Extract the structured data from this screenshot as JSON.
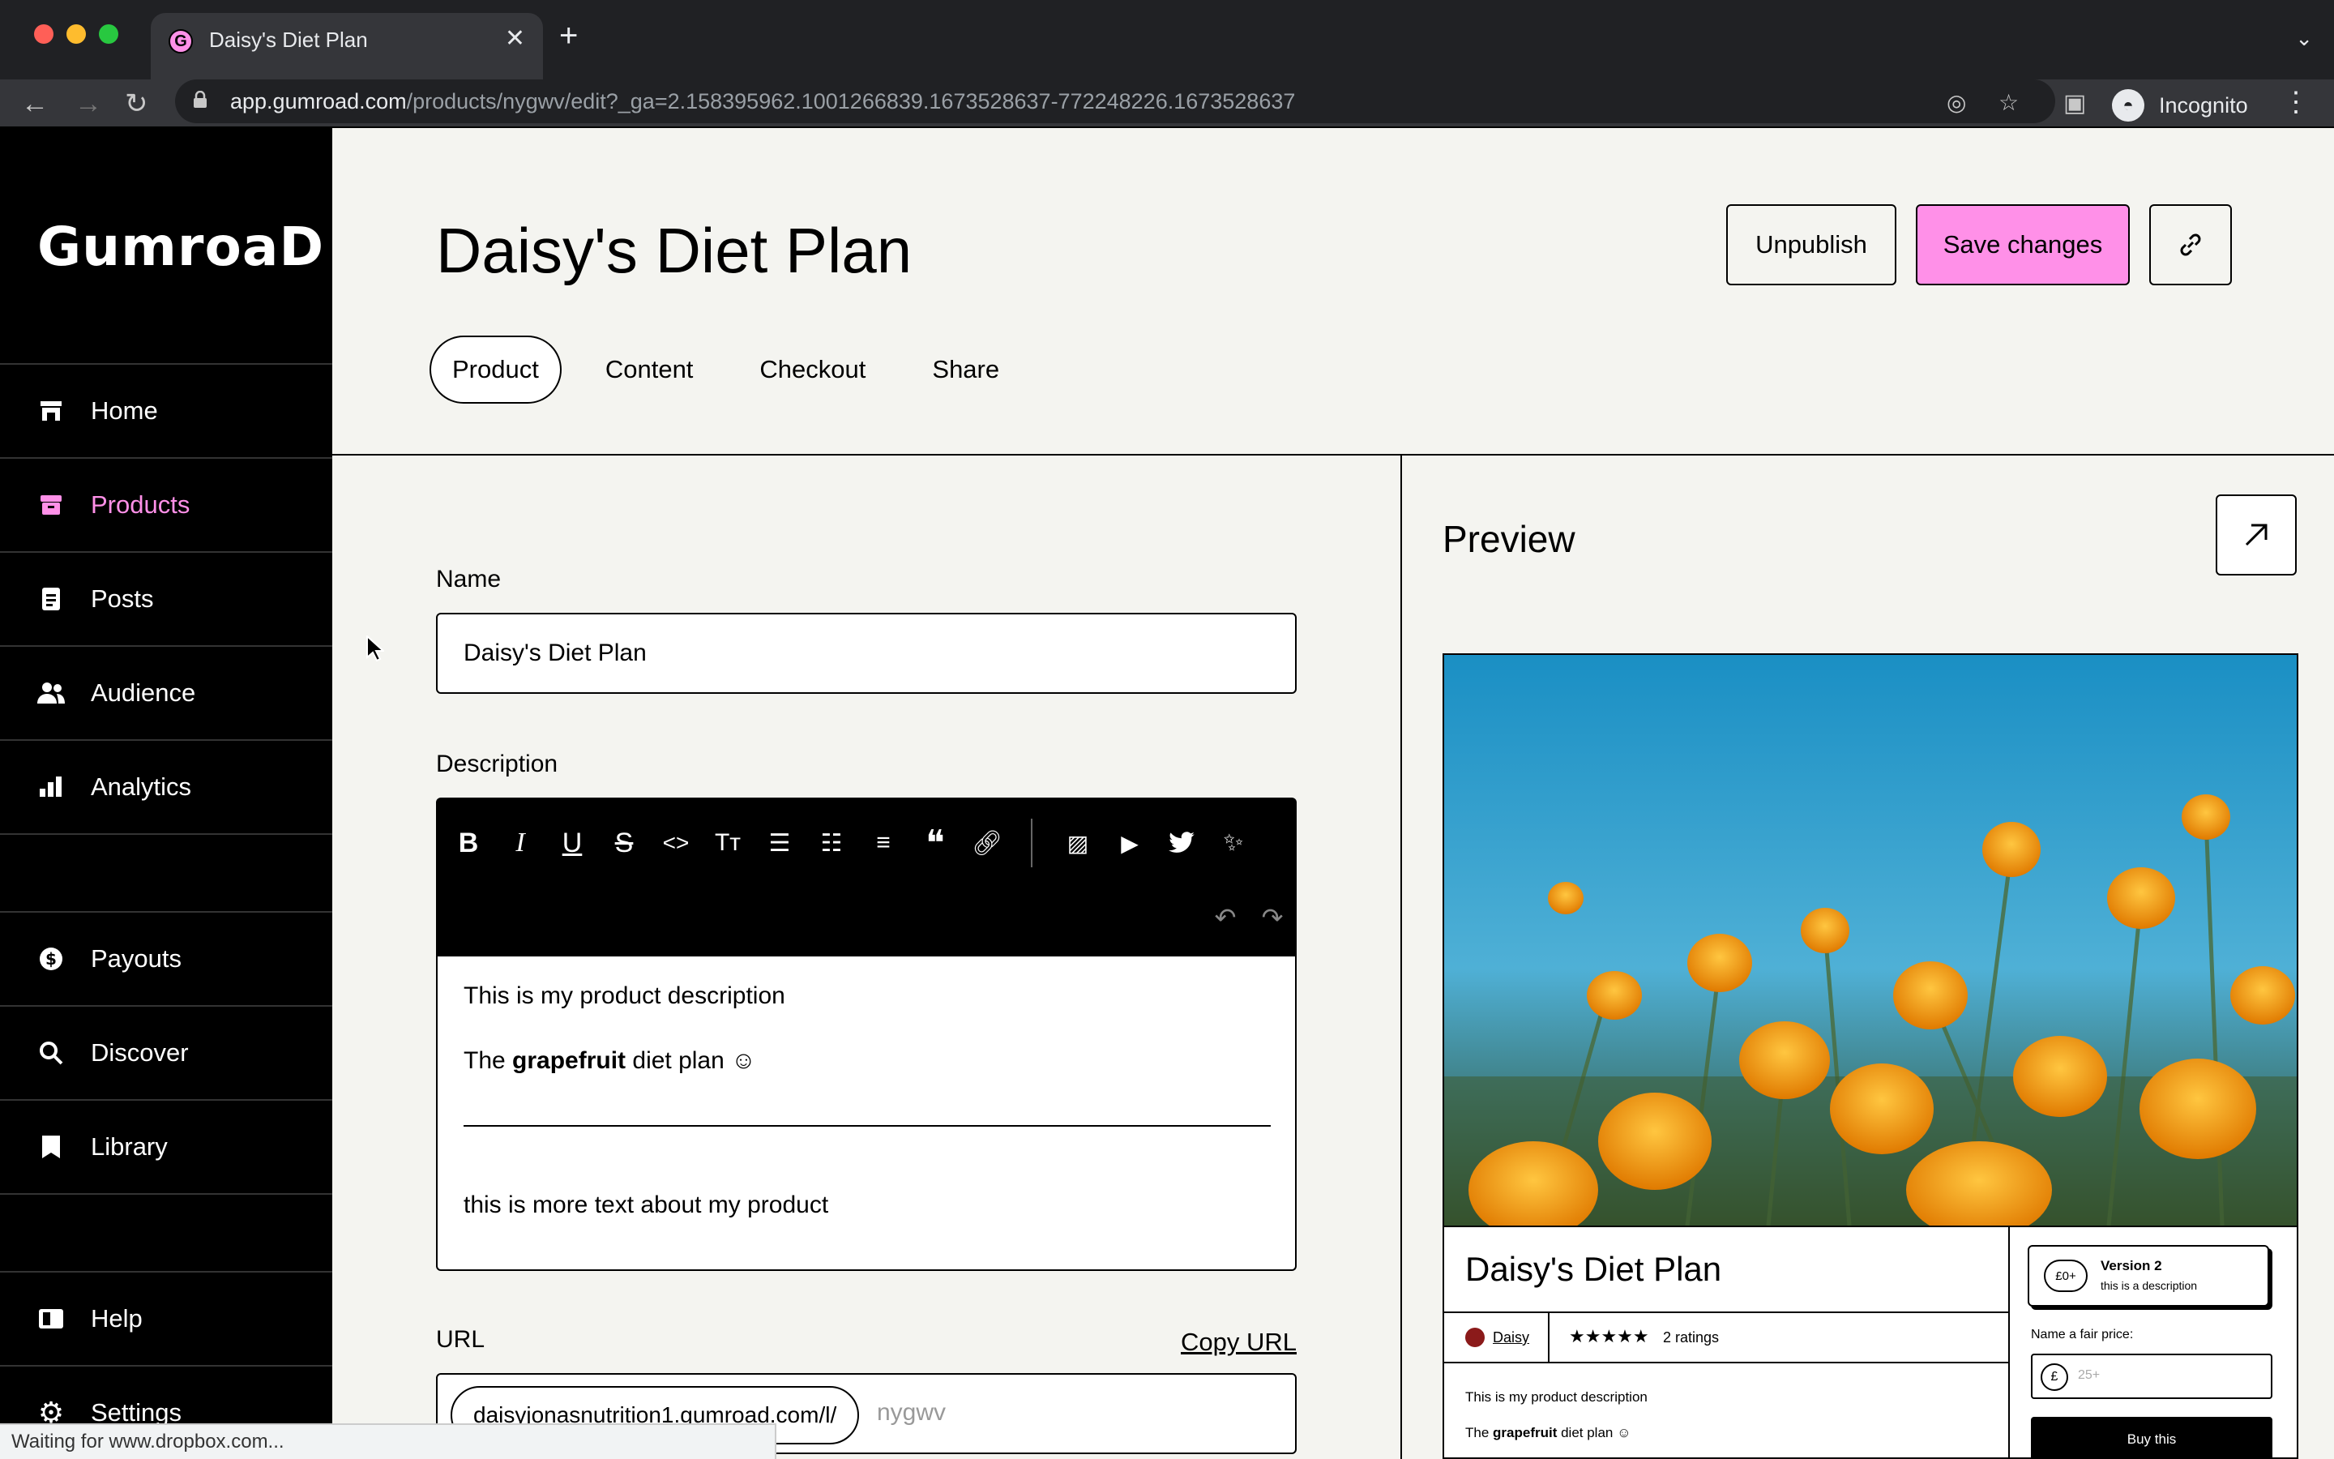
{
  "browser": {
    "tab_title": "Daisy's Diet Plan",
    "tab_close": "✕",
    "new_tab": "+",
    "url_host": "app.gumroad.com",
    "url_path": "/products/nygwv/edit?_ga=2.158395962.1001266839.1673528637-772248226.1673528637",
    "profile_label": "Incognito",
    "status_text": "Waiting for www.dropbox.com..."
  },
  "sidebar": {
    "logo": "GumroaD",
    "items": [
      {
        "label": "Home",
        "icon": "store-icon"
      },
      {
        "label": "Products",
        "icon": "archive-icon"
      },
      {
        "label": "Posts",
        "icon": "document-icon"
      },
      {
        "label": "Audience",
        "icon": "people-icon"
      },
      {
        "label": "Analytics",
        "icon": "bar-chart-icon"
      },
      {
        "label": "Payouts",
        "icon": "dollar-circle-icon"
      },
      {
        "label": "Discover",
        "icon": "search-icon"
      },
      {
        "label": "Library",
        "icon": "bookmark-icon"
      },
      {
        "label": "Help",
        "icon": "book-icon"
      },
      {
        "label": "Settings",
        "icon": "gear-icon"
      }
    ],
    "active": "Products"
  },
  "header": {
    "title": "Daisy's Diet Plan",
    "unpublish_label": "Unpublish",
    "save_label": "Save changes",
    "tabs": [
      "Product",
      "Content",
      "Checkout",
      "Share"
    ],
    "active_tab": "Product"
  },
  "form": {
    "name_label": "Name",
    "name_value": "Daisy's Diet Plan",
    "description_label": "Description",
    "description": {
      "line1": "This is my product description",
      "line2_prefix": "The ",
      "line2_bold": "grapefruit",
      "line2_suffix": " diet plan ☺",
      "line3": "this is more text about my product"
    },
    "url_label": "URL",
    "copy_url_label": "Copy URL",
    "url_prefix": "daisyjonasnutrition1.gumroad.com/l/",
    "url_slug": "nygwv"
  },
  "preview": {
    "title": "Preview",
    "product_title": "Daisy's Diet Plan",
    "creator": "Daisy",
    "stars": "★★★★★",
    "ratings": "2 ratings",
    "desc_line1": "This is my product description",
    "desc_line2_prefix": "The ",
    "desc_line2_bold": "grapefruit",
    "desc_line2_suffix": " diet plan ☺",
    "variant_price": "£0+",
    "variant_name": "Version 2",
    "variant_desc": "this is a description",
    "fair_price_label": "Name a fair price:",
    "currency": "£",
    "price_placeholder": "25+",
    "buy_label": "Buy this"
  },
  "colors": {
    "accent_pink": "#ff90e8",
    "sidebar_bg": "#000000",
    "page_bg": "#f4f4f0"
  }
}
